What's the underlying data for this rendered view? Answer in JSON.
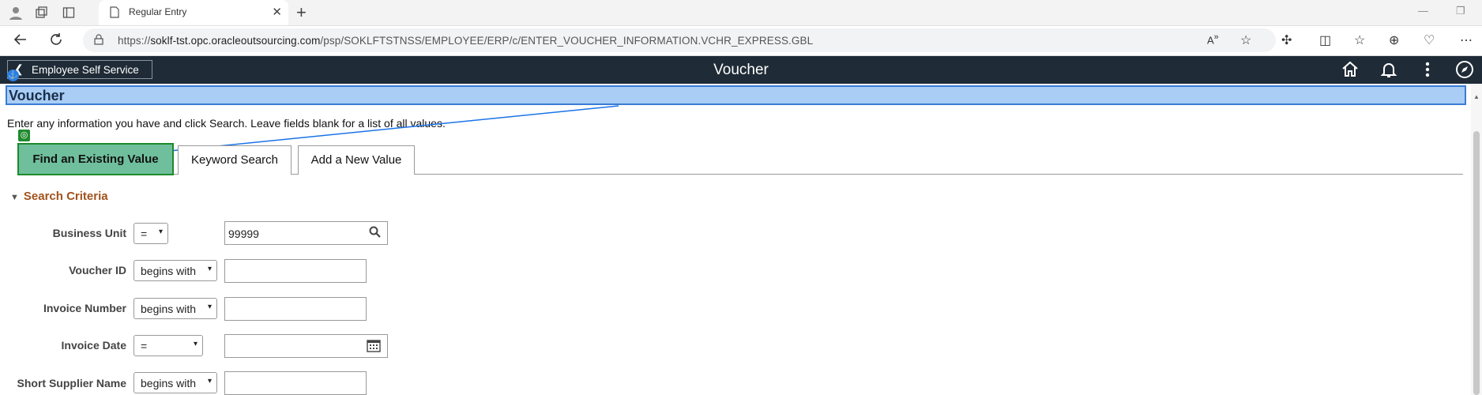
{
  "browser": {
    "tab_title": "Regular Entry",
    "url_prefix": "https://",
    "url_host": "soklf-tst.opc.oracleoutsourcing.com",
    "url_path": "/psp/SOKLFTSTNSS/EMPLOYEE/ERP/c/ENTER_VOUCHER_INFORMATION.VCHR_EXPRESS.GBL"
  },
  "header": {
    "back_label": "Employee Self Service",
    "title": "Voucher"
  },
  "page": {
    "title": "Voucher",
    "instructions": "Enter any information you have and click Search. Leave fields blank for a list of all values."
  },
  "tabs": [
    {
      "label": "Find an Existing Value",
      "active": true
    },
    {
      "label": "Keyword Search",
      "active": false
    },
    {
      "label": "Add a New Value",
      "active": false
    }
  ],
  "search": {
    "section_title": "Search Criteria",
    "fields": [
      {
        "label": "Business Unit",
        "operator": "=",
        "value": "99999"
      },
      {
        "label": "Voucher ID",
        "operator": "begins with",
        "value": ""
      },
      {
        "label": "Invoice Number",
        "operator": "begins with",
        "value": ""
      },
      {
        "label": "Invoice Date",
        "operator": "=",
        "value": ""
      },
      {
        "label": "Short Supplier Name",
        "operator": "begins with",
        "value": ""
      }
    ]
  },
  "colors": {
    "header_bg": "#1f2b36",
    "active_tab": "#6fbf9c",
    "section_title": "#a0521c",
    "highlight": "#a9cdf5"
  }
}
